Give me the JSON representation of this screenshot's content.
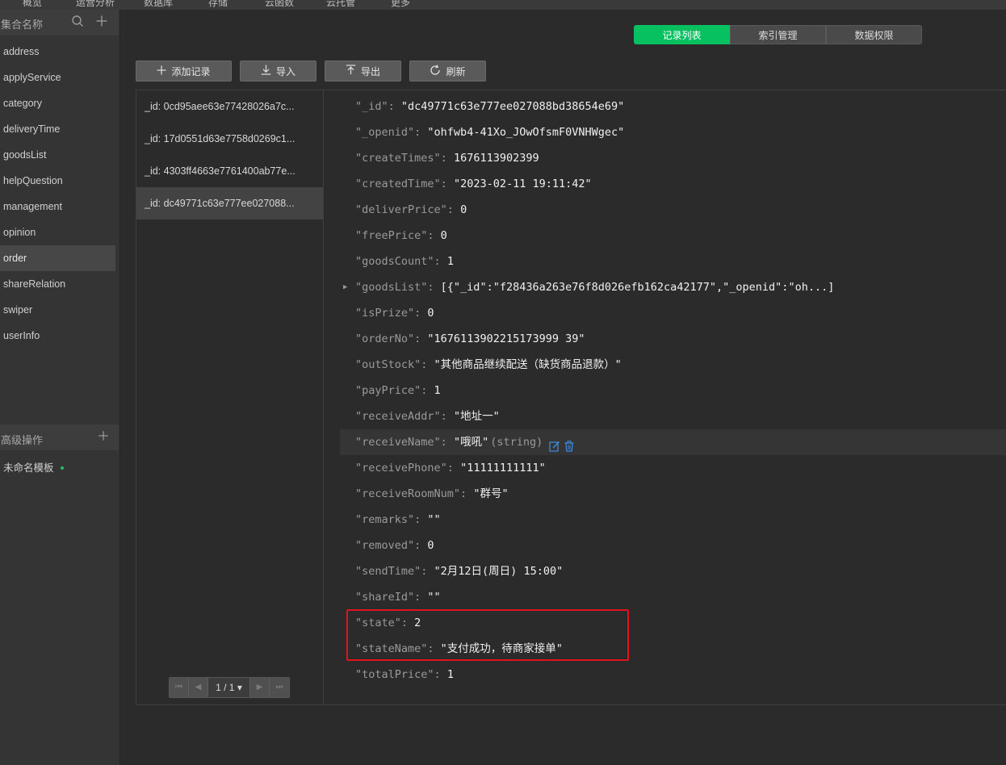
{
  "topnav": [
    "概览",
    "运营分析",
    "数据库",
    "存储",
    "云函数",
    "云托管",
    "更多"
  ],
  "sidebar": {
    "header_label": "集合名称",
    "collections": [
      "address",
      "applyService",
      "category",
      "deliveryTime",
      "goodsList",
      "helpQuestion",
      "management",
      "opinion",
      "order",
      "shareRelation",
      "swiper",
      "userInfo"
    ],
    "active_collection": "order",
    "advanced_label": "高级操作",
    "template_label": "未命名模板"
  },
  "tabs": [
    "记录列表",
    "索引管理",
    "数据权限"
  ],
  "active_tab": "记录列表",
  "toolbar": {
    "add_label": "添加记录",
    "import_label": "导入",
    "export_label": "导出",
    "refresh_label": "刷新"
  },
  "records": [
    "_id: 0cd95aee63e77428026a7c...",
    "_id: 17d0551d63e7758d0269c1...",
    "_id: 4303ff4663e7761400ab77e...",
    "_id: dc49771c63e777ee027088..."
  ],
  "active_record": 3,
  "pager": {
    "label": "1 / 1"
  },
  "fields": [
    {
      "key": "\"_id\"",
      "value": "\"dc49771c63e777ee027088bd38654e69\""
    },
    {
      "key": "\"_openid\"",
      "value": "\"ohfwb4-41Xo_JOwOfsmF0VNHWgec\""
    },
    {
      "key": "\"createTimes\"",
      "value": "1676113902399"
    },
    {
      "key": "\"createdTime\"",
      "value": "\"2023-02-11 19:11:42\""
    },
    {
      "key": "\"deliverPrice\"",
      "value": "0"
    },
    {
      "key": "\"freePrice\"",
      "value": "0"
    },
    {
      "key": "\"goodsCount\"",
      "value": "1"
    },
    {
      "key": "\"goodsList\"",
      "value": "[{\"_id\":\"f28436a263e76f8d026efb162ca42177\",\"_openid\":\"oh...]"
    },
    {
      "key": "\"isPrize\"",
      "value": "0"
    },
    {
      "key": "\"orderNo\"",
      "value": "\"1676113902215173999 39\""
    },
    {
      "key": "\"outStock\"",
      "value": "\"其他商品继续配送（缺货商品退款）\""
    },
    {
      "key": "\"payPrice\"",
      "value": "1"
    },
    {
      "key": "\"receiveAddr\"",
      "value": "\"地址一\""
    },
    {
      "key": "\"receiveName\"",
      "value": "\"哦吼\"",
      "type": "(string)"
    },
    {
      "key": "\"receivePhone\"",
      "value": "\"11111111111\""
    },
    {
      "key": "\"receiveRoomNum\"",
      "value": "\"群号\""
    },
    {
      "key": "\"remarks\"",
      "value": "\"\""
    },
    {
      "key": "\"removed\"",
      "value": "0"
    },
    {
      "key": "\"sendTime\"",
      "value": "\"2月12日(周日) 15:00\""
    },
    {
      "key": "\"shareId\"",
      "value": "\"\""
    },
    {
      "key": "\"state\"",
      "value": "2"
    },
    {
      "key": "\"stateName\"",
      "value": "\"支付成功，待商家接单\""
    },
    {
      "key": "\"totalPrice\"",
      "value": "1"
    }
  ],
  "colors": {
    "accent": "#07c160",
    "highlight_box": "#e0131d",
    "edit_icon": "#3b8fe8"
  },
  "icons": {
    "search": "search-icon",
    "add": "plus-icon",
    "import": "download-icon",
    "export": "upload-icon",
    "refresh": "refresh-icon",
    "expand": "triangle-right-icon",
    "edit": "edit-icon",
    "delete": "trash-icon"
  }
}
